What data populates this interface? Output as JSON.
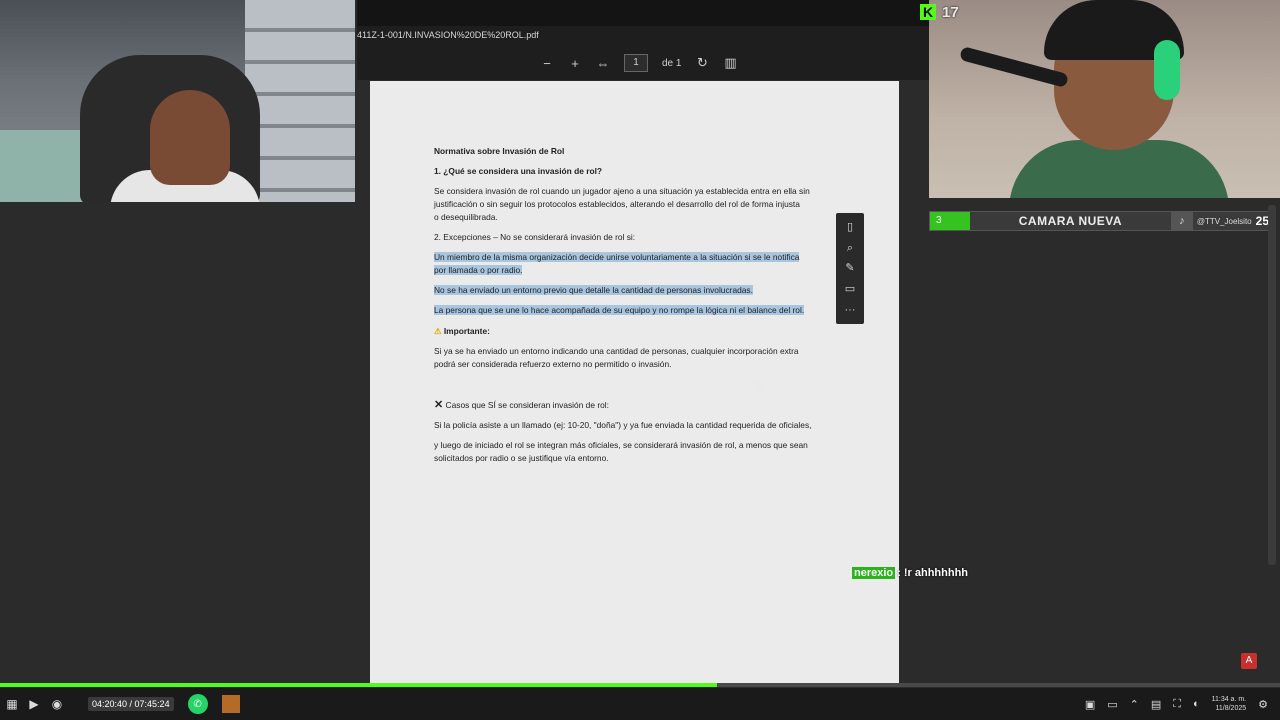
{
  "kick": {
    "count": "17",
    "logo": "K"
  },
  "camera_bar": {
    "left_num": "3",
    "title": "CAMARA NUEVA",
    "handle": "@TTV_Joelsito",
    "right_num": "25"
  },
  "pdf": {
    "filename": "411Z-1-001/N.INVASION%20DE%20ROL.pdf",
    "page_current": "1",
    "page_of": "de 1",
    "doc": {
      "title": "Normativa sobre Invasión de Rol",
      "q1": "1. ¿Qué se considera una invasión de rol?",
      "p1a": " Se considera invasión de rol cuando un jugador ajeno a una situación ya establecida entra en ella sin",
      "p1b": "justificación o sin seguir los protocolos establecidos, alterando el desarrollo del rol de forma injusta",
      "p1c": "o desequilibrada.",
      "q2": "2. Excepciones – No se considerará invasión de rol si:",
      "e1a": "Un miembro de la misma organización decide unirse voluntariamente a la situación  si se le notifica",
      "e1b": "por llamada o por radio.",
      "e2": "No se ha enviado un entorno previo que detalle la cantidad de personas involucradas.",
      "e3": "La persona que se une lo hace acompañada de su equipo y no rompe la lógica ni el balance del rol.",
      "imp_icon": "⚠",
      "imp_label": "Importante:",
      "imp_a": " Si ya se ha enviado un entorno indicando una cantidad de personas, cualquier incorporación extra",
      "imp_b": "podrá ser considerada refuerzo externo no permitido o invasión.",
      "cases_icon": "✕",
      "cases_label": "Casos que SÍ se consideran invasión de rol:",
      "c1": "Si la policía asiste a un llamado (ej: 10-20, \"doña\") y ya fue enviada la cantidad requerida de oficiales,",
      "c2a": " y luego de iniciado el rol se integran más oficiales, se considerará invasión de rol, a menos que sean",
      "c2b": "solicitados por radio o se justifique vía entorno."
    }
  },
  "chat": {
    "user": "nerexio",
    "text": ": !r ahhhhhhh"
  },
  "player": {
    "time": "04:20:40 / 07:45:24",
    "progress_fraction": 0.56
  },
  "tray": {
    "clock_time": "11:34 a. m.",
    "clock_date": "11/8/2025"
  },
  "icons": {
    "float_tools": [
      "page-icon",
      "search-icon",
      "highlight-icon",
      "comment-icon",
      "more-icon"
    ],
    "float_glyphs": [
      "▯",
      "⌕",
      "✎",
      "▭",
      "···"
    ]
  },
  "colors": {
    "kick_green": "#53fc18",
    "highlight": "#a9c6e0",
    "chat_user": "#2db11d"
  }
}
